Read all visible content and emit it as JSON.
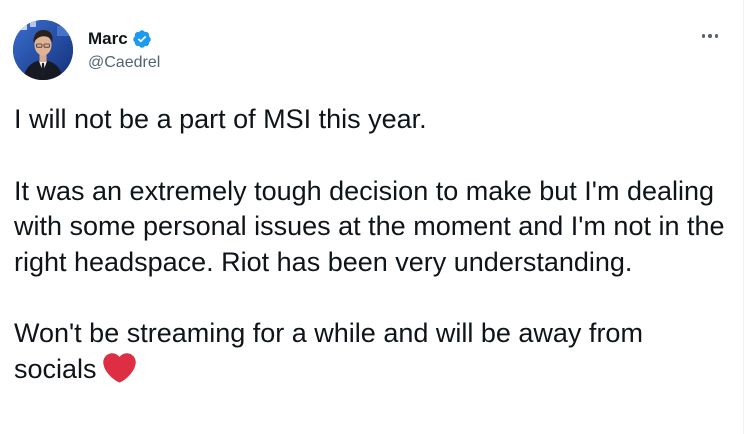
{
  "author": {
    "name": "Marc",
    "handle": "@Caedrel",
    "verified": true
  },
  "tweet": {
    "paragraphs": [
      "I will not be a part of MSI this year.",
      "It was an extremely tough decision to make but I'm dealing with some personal issues at the moment and I'm not in the right headspace. Riot has been very understanding.",
      "Won't be streaming for a while and will be away from socials"
    ],
    "trailing_emoji": "red-heart"
  },
  "icons": {
    "verified": "verified-badge-icon",
    "more": "more-options-icon",
    "emoji": "red-heart-icon"
  },
  "colors": {
    "text": "#0f1419",
    "secondary": "#536471",
    "verified": "#1d9bf0",
    "heart": "#dd2e44"
  }
}
